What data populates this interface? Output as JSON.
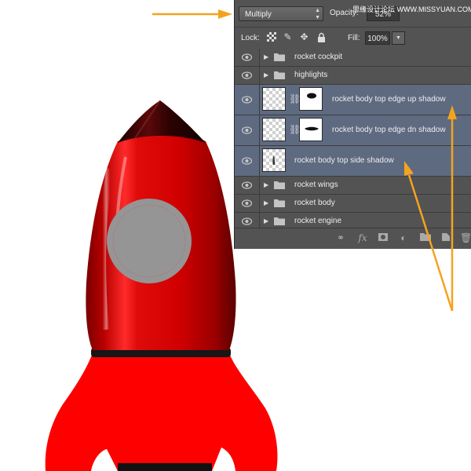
{
  "layers_panel": {
    "blend_mode": "Multiply",
    "opacity_label": "Opacity:",
    "opacity_value": "52%",
    "watermark": "思缘设计论坛  WWW.MISSYUAN.COM",
    "lock_label": "Lock:",
    "fill_label": "Fill:",
    "fill_value": "100%",
    "layers": [
      {
        "name": "rocket cockpit",
        "type": "group"
      },
      {
        "name": "highlights",
        "type": "group"
      },
      {
        "name": "rocket body top edge up shadow",
        "type": "masked-layer",
        "selected": true
      },
      {
        "name": "rocket body top edge dn shadow",
        "type": "masked-layer",
        "selected": true
      },
      {
        "name": "rocket body top side shadow",
        "type": "layer",
        "selected": true
      },
      {
        "name": "rocket wings",
        "type": "group"
      },
      {
        "name": "rocket body",
        "type": "group"
      },
      {
        "name": "rocket engine",
        "type": "group"
      }
    ]
  },
  "colors": {
    "panel_bg": "#535353",
    "selected_row": "#5e6a80",
    "rocket_red": "#e01010",
    "wing_red": "#ff0000",
    "porthole_gray": "#959595",
    "annotation_orange": "#f5a31f"
  },
  "icons": [
    "eye-icon",
    "folder-icon",
    "expand-arrow-icon",
    "chain-link-icon",
    "lock-transparent-icon",
    "lock-brush-icon",
    "lock-move-icon",
    "lock-all-icon",
    "link-layers-icon",
    "fx-icon",
    "add-mask-icon",
    "adjustment-icon",
    "new-group-icon",
    "new-layer-icon",
    "trash-icon"
  ]
}
